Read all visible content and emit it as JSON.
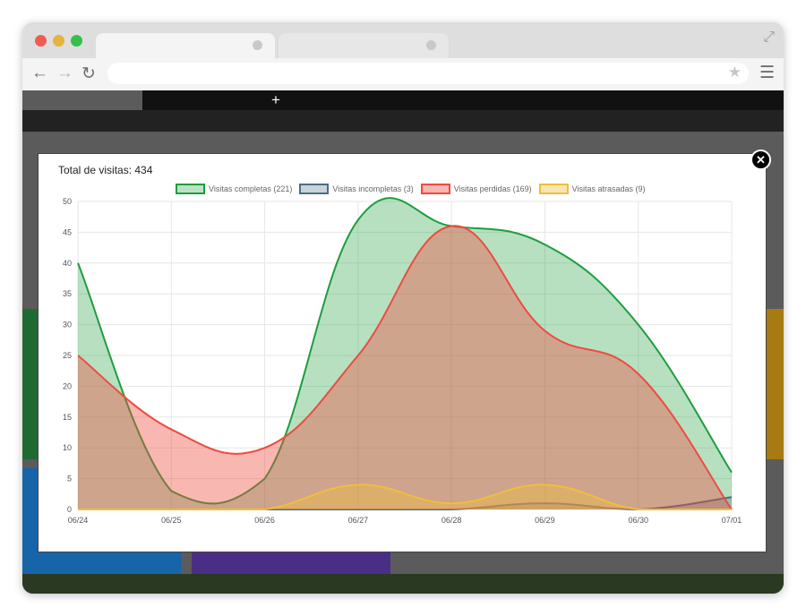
{
  "modal": {
    "title": "Total de visitas: 434"
  },
  "colors": {
    "completas": "#1e9e3e",
    "incompletas": "#4a6f82",
    "perdidas": "#ef4b3f",
    "atrasadas": "#f0be3c"
  },
  "chart_data": {
    "type": "area",
    "categories": [
      "06/24",
      "06/25",
      "06/26",
      "06/27",
      "06/28",
      "06/29",
      "06/30",
      "07/01"
    ],
    "ylim": [
      0,
      50
    ],
    "yticks": [
      0,
      5,
      10,
      15,
      20,
      25,
      30,
      35,
      40,
      45,
      50
    ],
    "grid": true,
    "legend_position": "top",
    "series": [
      {
        "name": "Visitas completas (221)",
        "values": [
          40,
          3,
          5,
          47,
          46,
          43,
          30,
          6
        ]
      },
      {
        "name": "Visitas incompletas (3)",
        "values": [
          0,
          0,
          0,
          0,
          0,
          1,
          0,
          2
        ]
      },
      {
        "name": "Visitas perdidas (169)",
        "values": [
          25,
          13,
          10,
          25,
          46,
          29,
          22,
          0
        ]
      },
      {
        "name": "Visitas atrasadas (9)",
        "values": [
          0,
          0,
          0,
          4,
          1,
          4,
          0,
          0
        ]
      }
    ]
  }
}
